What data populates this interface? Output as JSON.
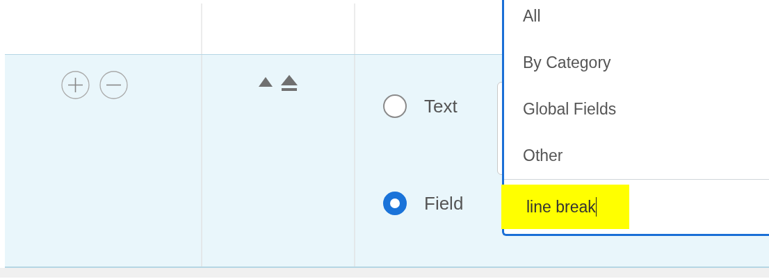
{
  "row": {
    "sort_buttons": [
      {
        "kind": "up"
      },
      {
        "kind": "top"
      }
    ],
    "options": [
      {
        "label": "Text",
        "selected": false
      },
      {
        "label": "Field",
        "selected": true
      }
    ]
  },
  "dropdown": {
    "items": [
      {
        "label": "All"
      },
      {
        "label": "By Category"
      },
      {
        "label": "Global Fields"
      },
      {
        "label": "Other"
      }
    ],
    "search": {
      "value": "line break",
      "highlighted": true
    }
  }
}
